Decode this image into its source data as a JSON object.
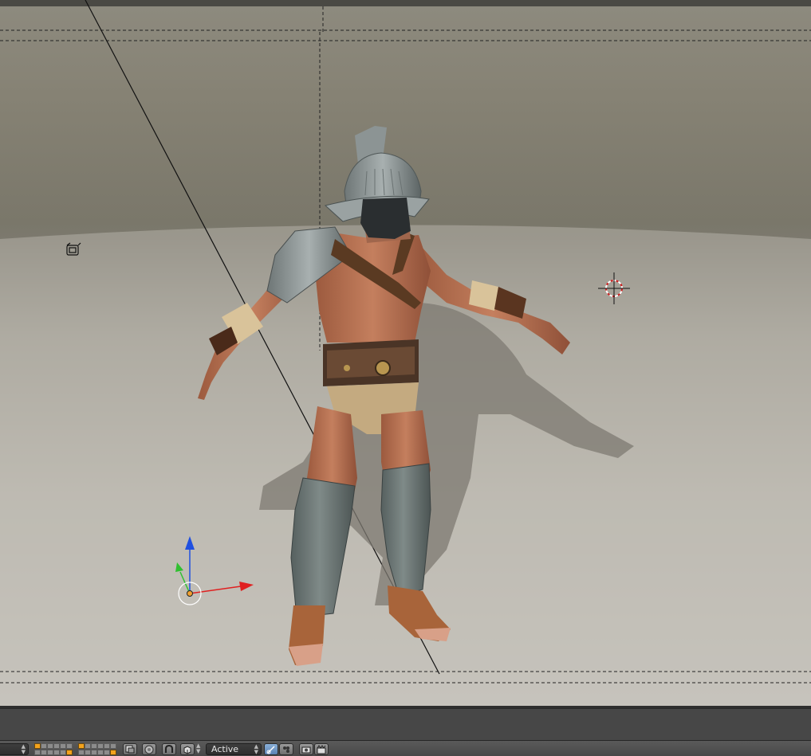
{
  "viewport": {
    "colors": {
      "axis_x": "#e02020",
      "axis_y": "#30c030",
      "axis_z": "#2050e0",
      "cursor": "#cc2020",
      "origin": "#f0a030"
    },
    "icons": [
      "camera-frame",
      "lamp-object",
      "3d-cursor",
      "transform-manipulator",
      "gladiator-model"
    ]
  },
  "header": {
    "pivot_dropdown": {
      "value": "Active"
    },
    "layers": {
      "active_first_block": [
        0,
        5
      ],
      "active_second_block": [
        0,
        5
      ]
    }
  }
}
